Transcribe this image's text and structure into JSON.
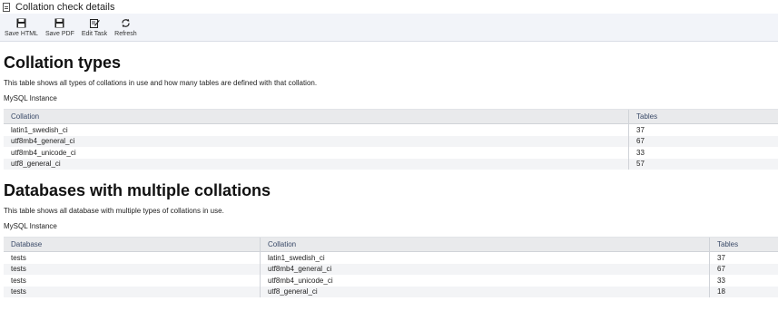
{
  "window": {
    "title": "Collation check details"
  },
  "toolbar": {
    "save_html": "Save HTML",
    "save_pdf": "Save PDF",
    "edit_task": "Edit Task",
    "refresh": "Refresh"
  },
  "section1": {
    "heading": "Collation types",
    "description": "This table shows all types of collations in use and how many tables are defined with that collation.",
    "instance": "MySQL Instance",
    "columns": [
      "Collation",
      "Tables"
    ],
    "rows": [
      [
        "latin1_swedish_ci",
        "37"
      ],
      [
        "utf8mb4_general_ci",
        "67"
      ],
      [
        "utf8mb4_unicode_ci",
        "33"
      ],
      [
        "utf8_general_ci",
        "57"
      ]
    ]
  },
  "section2": {
    "heading": "Databases with multiple collations",
    "description": "This table shows all database with multiple types of collations in use.",
    "instance": "MySQL Instance",
    "columns": [
      "Database",
      "Collation",
      "Tables"
    ],
    "rows": [
      [
        "tests",
        "latin1_swedish_ci",
        "37"
      ],
      [
        "tests",
        "utf8mb4_general_ci",
        "67"
      ],
      [
        "tests",
        "utf8mb4_unicode_ci",
        "33"
      ],
      [
        "tests",
        "utf8_general_ci",
        "18"
      ]
    ]
  }
}
